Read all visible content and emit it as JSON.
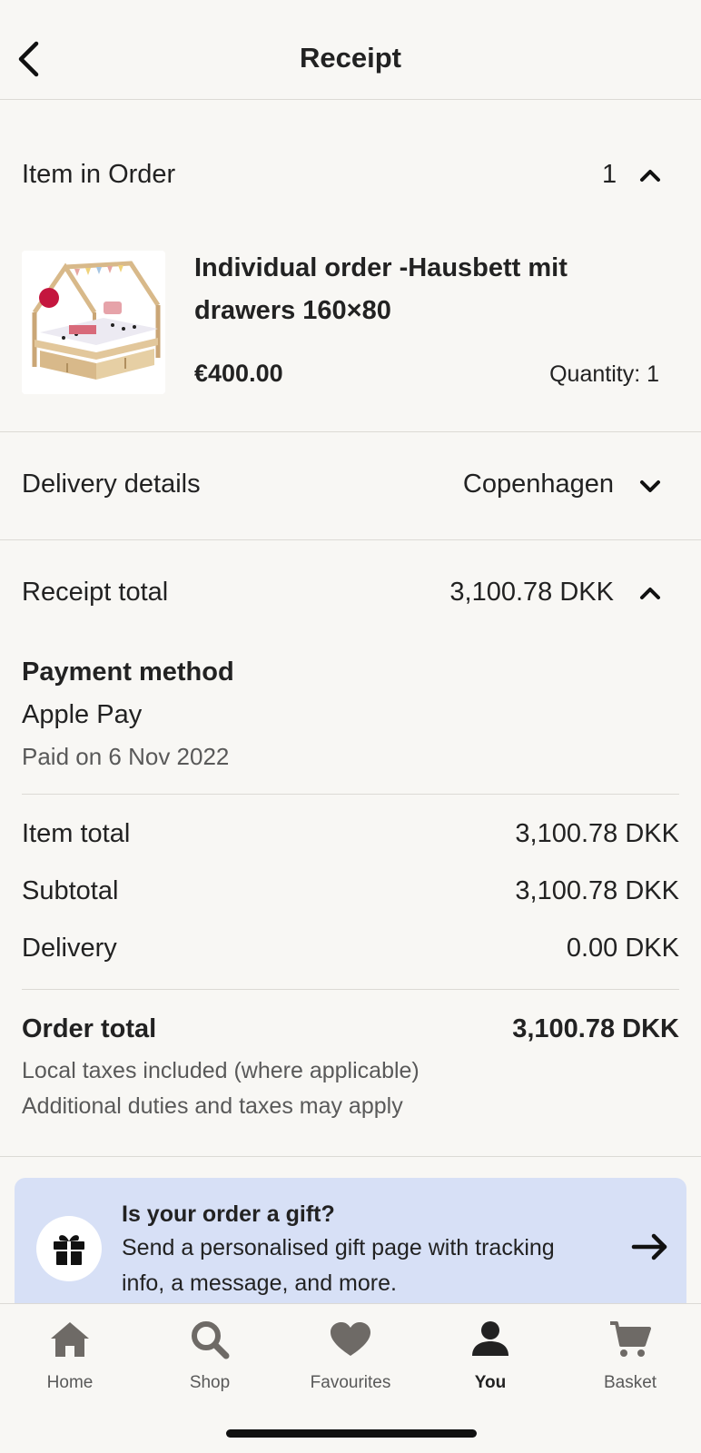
{
  "header": {
    "title": "Receipt"
  },
  "order_items": {
    "label": "Item in Order",
    "count": "1",
    "item": {
      "title": "Individual order -Hausbett mit drawers 160×80",
      "price": "€400.00",
      "quantity": "Quantity: 1"
    }
  },
  "delivery": {
    "label": "Delivery details",
    "value": "Copenhagen"
  },
  "receipt_total": {
    "label": "Receipt total",
    "value": "3,100.78 DKK",
    "payment_heading": "Payment method",
    "payment_method": "Apple Pay",
    "paid_on": "Paid on 6 Nov 2022",
    "lines": [
      {
        "label": "Item total",
        "value": "3,100.78 DKK"
      },
      {
        "label": "Subtotal",
        "value": "3,100.78 DKK"
      },
      {
        "label": "Delivery",
        "value": "0.00 DKK"
      }
    ],
    "order_total_label": "Order total",
    "order_total_value": "3,100.78 DKK",
    "tax_note": "Local taxes included (where applicable)",
    "duties_note": "Additional duties and taxes may apply"
  },
  "gift_banner": {
    "title": "Is your order a gift?",
    "text": "Send a personalised gift page with tracking info, a message, and more."
  },
  "tabs": [
    {
      "label": "Home",
      "icon": "home-icon",
      "active": false
    },
    {
      "label": "Shop",
      "icon": "search-icon",
      "active": false
    },
    {
      "label": "Favourites",
      "icon": "heart-icon",
      "active": false
    },
    {
      "label": "You",
      "icon": "person-icon",
      "active": true
    },
    {
      "label": "Basket",
      "icon": "cart-icon",
      "active": false
    }
  ],
  "colors": {
    "background": "#f8f7f4",
    "text": "#222222",
    "muted": "#595959",
    "gift_banner_bg": "#d7e0f6",
    "tab_icon_inactive": "#6e6a66"
  }
}
